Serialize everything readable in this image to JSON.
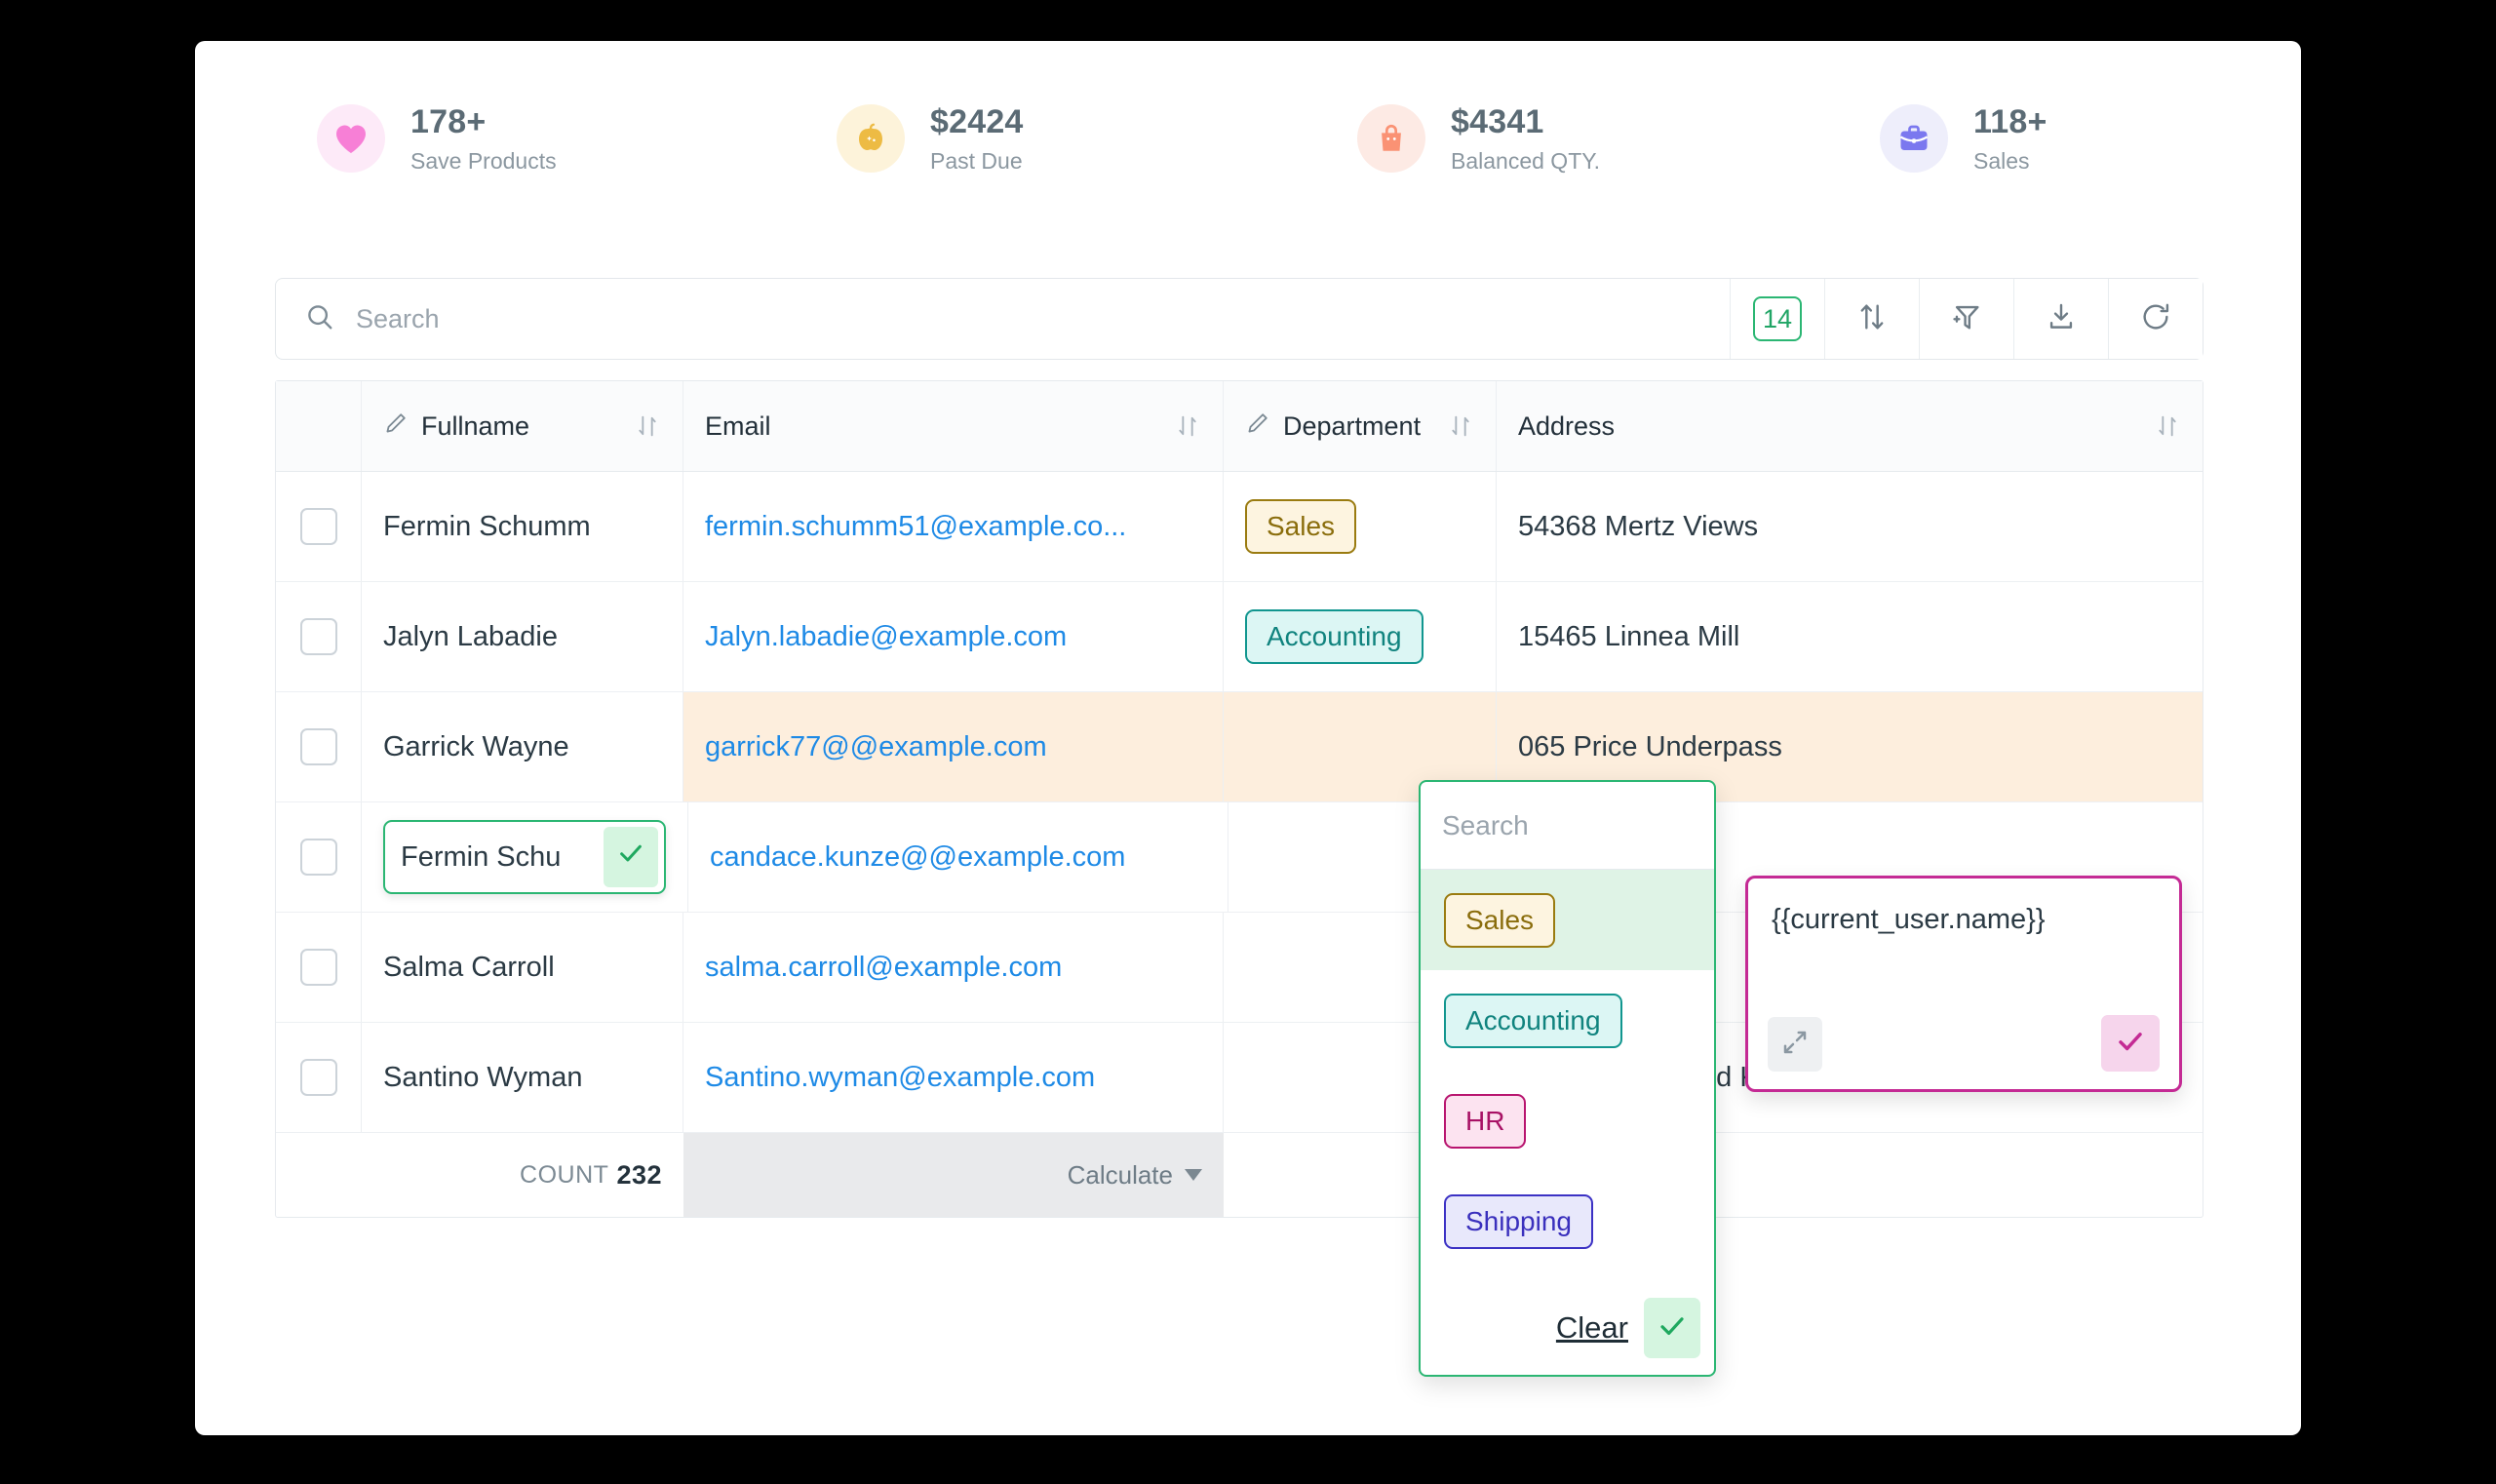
{
  "stats": [
    {
      "value": "178+",
      "label": "Save Products",
      "icon": "heart-icon",
      "color": "#f77fd6",
      "bubble": "#fdeaf8"
    },
    {
      "value": "$2424",
      "label": "Past Due",
      "icon": "pumpkin-icon",
      "color": "#edbb44",
      "bubble": "#fdf3da"
    },
    {
      "value": "$4341",
      "label": "Balanced QTY.",
      "icon": "bag-icon",
      "color": "#fa9274",
      "bubble": "#fdeae4"
    },
    {
      "value": "118+",
      "label": "Sales",
      "icon": "briefcase-icon",
      "color": "#7b78ef",
      "bubble": "#eeeefb"
    }
  ],
  "search": {
    "placeholder": "Search",
    "value": "",
    "count_badge": "14",
    "tools": [
      "sort-icon",
      "filter-add-icon",
      "download-icon",
      "refresh-icon"
    ]
  },
  "table": {
    "columns": [
      {
        "key": "check",
        "label": "",
        "editable": false,
        "sortable": false
      },
      {
        "key": "name",
        "label": "Fullname",
        "editable": true,
        "sortable": true
      },
      {
        "key": "email",
        "label": "Email",
        "editable": false,
        "sortable": true
      },
      {
        "key": "dept",
        "label": "Department",
        "editable": true,
        "sortable": true
      },
      {
        "key": "addr",
        "label": "Address",
        "editable": false,
        "sortable": true
      }
    ],
    "rows": [
      {
        "name": "Fermin Schumm",
        "email": "fermin.schumm51@example.co...",
        "dept": "Sales",
        "dept_style": "chip-sales",
        "addr": "54368 Mertz Views",
        "highlight": false,
        "editing_name": false
      },
      {
        "name": "Jalyn Labadie",
        "email": "Jalyn.labadie@example.com",
        "dept": "Accounting",
        "dept_style": "chip-acct",
        "addr": "15465 Linnea Mill",
        "highlight": false,
        "editing_name": false
      },
      {
        "name": "Garrick Wayne",
        "email": "garrick77@@example.com",
        "dept": "",
        "dept_style": "",
        "addr": "065 Price Underpass",
        "highlight": true,
        "editing_name": false
      },
      {
        "name": "Fermin Schu",
        "email": "candace.kunze@@example.com",
        "dept": "",
        "dept_style": "",
        "addr": "",
        "highlight": false,
        "editing_name": true
      },
      {
        "name": "Salma Carroll",
        "email": "salma.carroll@example.com",
        "dept": "",
        "dept_style": "",
        "addr": "",
        "highlight": false,
        "editing_name": false
      },
      {
        "name": "Santino Wyman",
        "email": "Santino.wyman@example.com",
        "dept": "",
        "dept_style": "",
        "addr": "50663 Satterfield Knoll",
        "highlight": false,
        "editing_name": false
      }
    ],
    "footer": {
      "count_label": "COUNT",
      "count_value": "232",
      "calculate_label": "Calculate"
    }
  },
  "department_dropdown": {
    "search_placeholder": "Search",
    "search_value": "",
    "options": [
      {
        "label": "Sales",
        "style": "chip-sales",
        "selected": true
      },
      {
        "label": "Accounting",
        "style": "chip-acct",
        "selected": false
      },
      {
        "label": "HR",
        "style": "chip-hr",
        "selected": false
      },
      {
        "label": "Shipping",
        "style": "chip-ship",
        "selected": false
      }
    ],
    "clear_label": "Clear",
    "confirm_icon": "check-icon"
  },
  "address_editor": {
    "value": "{{current_user.name}}",
    "expand_icon": "expand-icon",
    "confirm_icon": "check-icon"
  },
  "colors": {
    "accent_green": "#2bb673",
    "link_blue": "#1e8ae6",
    "highlight_peach": "#fdeedd",
    "magenta": "#c42a94"
  }
}
